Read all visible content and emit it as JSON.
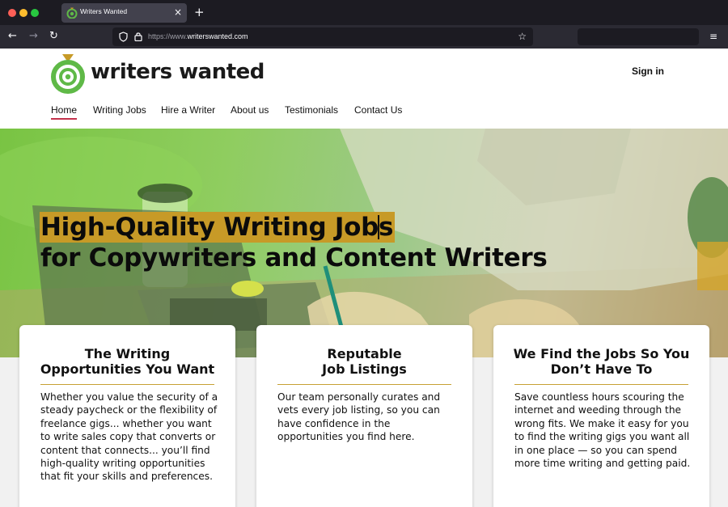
{
  "browser": {
    "tab_title": "Writers Wanted",
    "tab_close": "×",
    "new_tab": "+",
    "nav_back": "←",
    "nav_forward": "→",
    "nav_reload": "↻",
    "url_scheme": "https://www.",
    "url_domain": "writerswanted.com",
    "bookmark_star": "☆",
    "menu": "≡"
  },
  "site": {
    "logo_text": "writers wanted",
    "sign_in": "Sign in",
    "nav": [
      {
        "label": "Home",
        "active": true
      },
      {
        "label": "Writing Jobs"
      },
      {
        "label": "Hire a Writer"
      },
      {
        "label": "About us"
      },
      {
        "label": "Testimonials"
      },
      {
        "label": "Contact Us"
      }
    ]
  },
  "hero": {
    "headline_line1": "High-Quality Writing Jobs",
    "headline_line2": "for Copywriters and Content Writers"
  },
  "cards": [
    {
      "title_line1": "The Writing",
      "title_line2": "Opportunities You Want",
      "body": "Whether you value the security of a steady paycheck or the flexibility of freelance gigs... whether you want to write sales copy that converts or content that connects... you’ll find high-quality writing opportunities that fit your skills and preferences."
    },
    {
      "title_line1": "Reputable",
      "title_line2": "Job Listings",
      "body": "Our team personally curates and vets every job listing, so you can have confidence in the opportunities you find here."
    },
    {
      "title_line1": "We Find the Jobs So You",
      "title_line2": "Don’t Have To",
      "body": "Save countless hours scouring the internet and weeding through the wrong fits. We make it easy for you to find the writing gigs you want all in one place — so you can spend more time writing and getting paid."
    }
  ],
  "colors": {
    "brand_green": "#5fb947",
    "brand_gold": "#c79a27",
    "nav_active_underline": "#c3314b"
  }
}
